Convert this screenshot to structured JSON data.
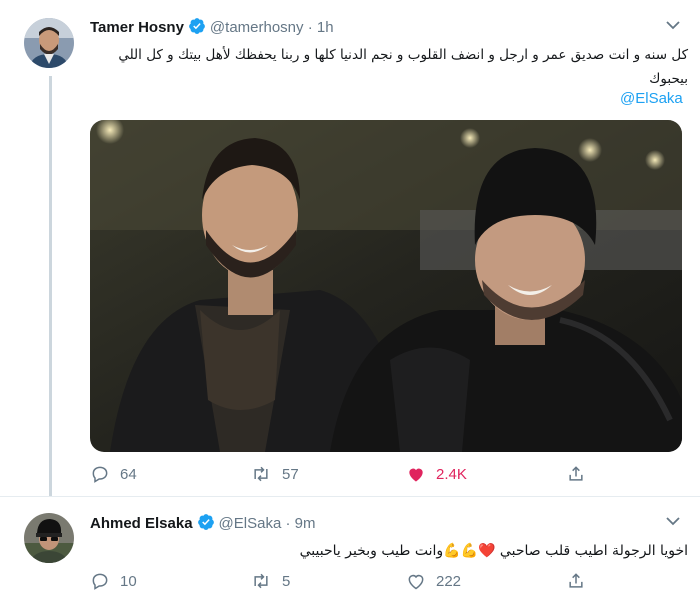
{
  "tweet1": {
    "author_name": "Tamer Hosny",
    "handle": "@tamerhosny",
    "separator": "·",
    "time": "1h",
    "text_line1": "كل سنه و انت صديق عمر و ارجل و انضف القلوب و نجم الدنيا كلها  و ربنا يحفظك لأهل بيتك و كل اللي",
    "text_line2": "بيحبوك",
    "mention": "@ElSaka",
    "replies": "64",
    "retweets": "57",
    "likes": "2.4K",
    "liked": true
  },
  "tweet2": {
    "author_name": "Ahmed Elsaka",
    "handle": "@ElSaka",
    "separator": "·",
    "time": "9m",
    "text": "اخويا الرجولة اطيب قلب صاحبي ❤️💪💪وانت طيب وبخير ياحبيبي",
    "replies": "10",
    "retweets": "5",
    "likes": "222"
  },
  "icons": {
    "verified": "verified-badge-icon",
    "reply": "reply-icon",
    "retweet": "retweet-icon",
    "like": "heart-icon",
    "share": "share-icon",
    "more": "chevron-down-icon"
  },
  "colors": {
    "accent": "#1da1f2",
    "like_active": "#e0245e",
    "muted": "#657786",
    "text": "#14171a"
  }
}
